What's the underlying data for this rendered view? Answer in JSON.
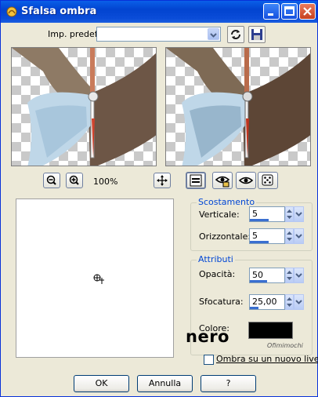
{
  "window": {
    "title": "Sfalsa ombra"
  },
  "preset": {
    "label": "Imp. predef.:",
    "value": ""
  },
  "zoom": {
    "level": "100%"
  },
  "offset": {
    "group_label": "Scostamento",
    "vertical_label": "Verticale:",
    "vertical_value": "5",
    "vertical_fill": 0.55,
    "horizontal_label": "Orizzontale:",
    "horizontal_value": "5",
    "horizontal_fill": 0.55
  },
  "attributes": {
    "group_label": "Attributi",
    "opacity_label": "Opacità:",
    "opacity_value": "50",
    "opacity_fill": 0.5,
    "blur_label": "Sfocatura:",
    "blur_value": "25,00",
    "blur_fill": 0.25,
    "color_label": "Colore:",
    "color_value": "#000000",
    "color_note": "nero"
  },
  "new_layer": {
    "label": "Ombra su un nuovo livello",
    "checked": false
  },
  "buttons": {
    "ok": "OK",
    "cancel": "Annulla",
    "help": "?"
  },
  "watermark": "Ofimimochi"
}
